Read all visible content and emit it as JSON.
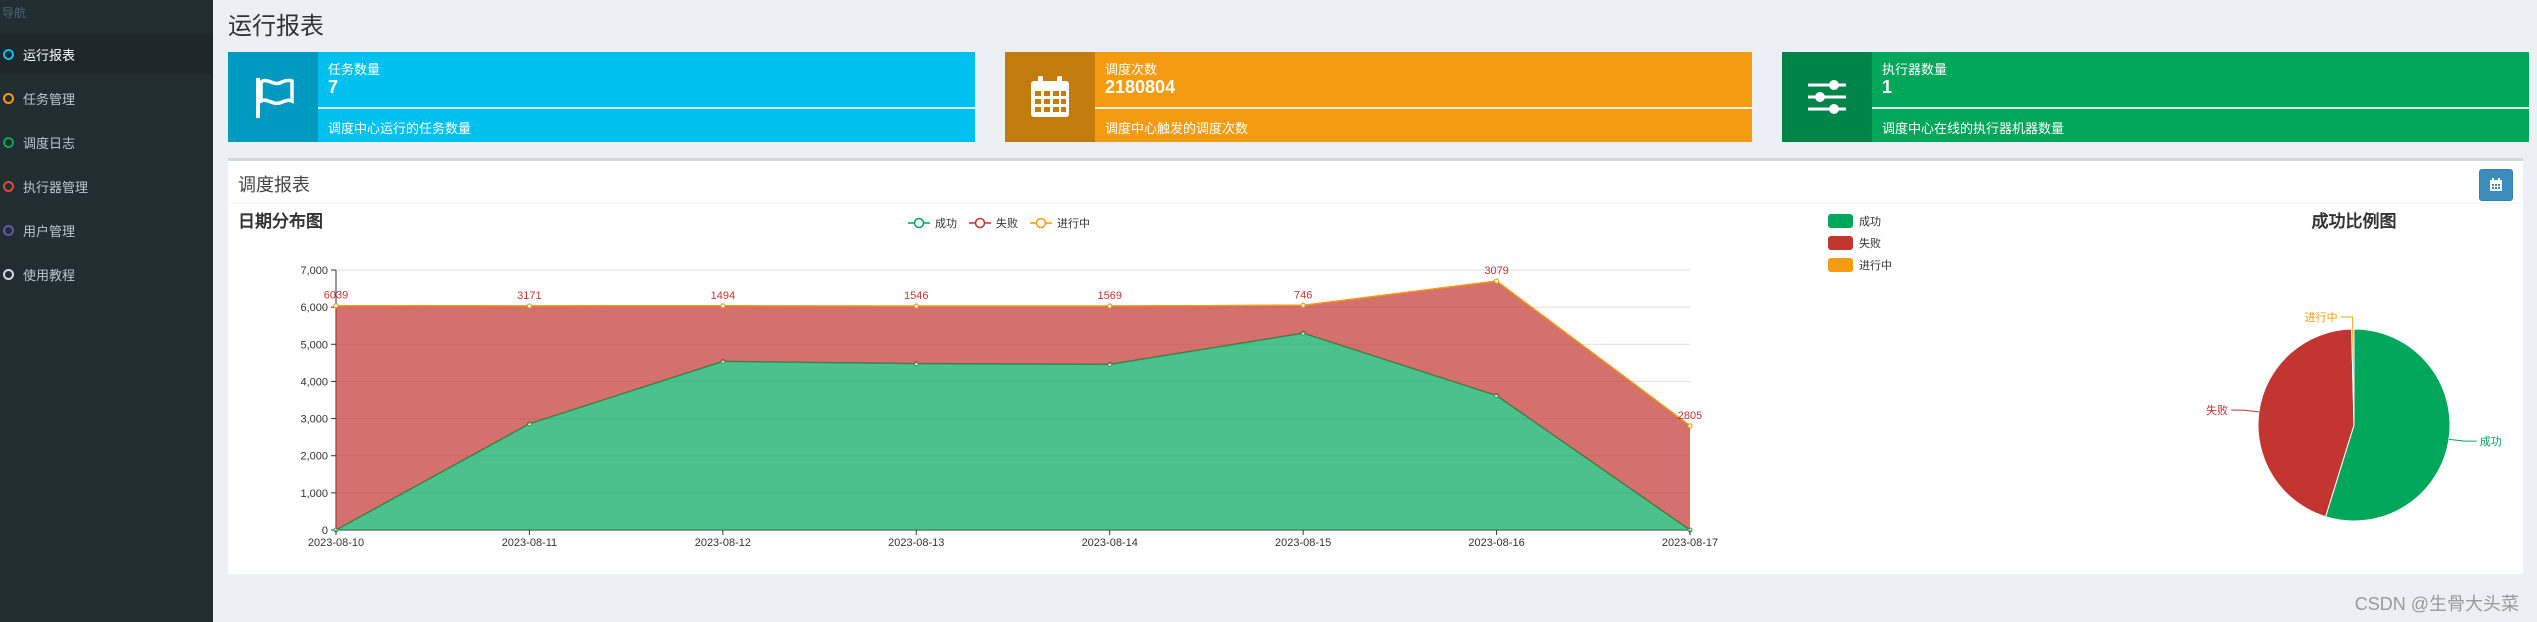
{
  "sidebar": {
    "header": "导航",
    "items": [
      {
        "label": "运行报表",
        "color": "#00c0ef"
      },
      {
        "label": "任务管理",
        "color": "#f39c12"
      },
      {
        "label": "调度日志",
        "color": "#00a65a"
      },
      {
        "label": "执行器管理",
        "color": "#dd4b39"
      },
      {
        "label": "用户管理",
        "color": "#605ca8"
      },
      {
        "label": "使用教程",
        "color": "#d2d6de"
      }
    ]
  },
  "page": {
    "title": "运行报表"
  },
  "info_boxes": [
    {
      "label": "任务数量",
      "value": "7",
      "desc": "调度中心运行的任务数量",
      "color": "#00c0ef",
      "icon": "flag-icon"
    },
    {
      "label": "调度次数",
      "value": "2180804",
      "desc": "调度中心触发的调度次数",
      "color": "#f39c12",
      "icon": "calendar-icon"
    },
    {
      "label": "执行器数量",
      "value": "1",
      "desc": "调度中心在线的执行器机器数量",
      "color": "#00a65a",
      "icon": "sliders-icon"
    }
  ],
  "report": {
    "title": "调度报表",
    "button_icon": "calendar-icon"
  },
  "watermark": "CSDN @生骨大头菜",
  "chart_data": [
    {
      "type": "area",
      "title": "日期分布图",
      "categories": [
        "2023-08-10",
        "2023-08-11",
        "2023-08-12",
        "2023-08-13",
        "2023-08-14",
        "2023-08-15",
        "2023-08-16",
        "2023-08-17"
      ],
      "ylim": [
        0,
        7000
      ],
      "yticks": [
        "0",
        "1,000",
        "2,000",
        "3,000",
        "4,000",
        "5,000",
        "6,000",
        "7,000"
      ],
      "stacked": true,
      "grid": true,
      "legend_position": "top",
      "series": [
        {
          "name": "成功",
          "color": "#00a65a",
          "values": [
            0,
            2860,
            4540,
            4480,
            4460,
            5300,
            3620,
            0
          ]
        },
        {
          "name": "失败",
          "color": "#c23531",
          "values": [
            6039,
            3171,
            1494,
            1546,
            1569,
            746,
            3079,
            2805
          ]
        },
        {
          "name": "进行中",
          "color": "#f39c12",
          "values": [
            0,
            0,
            0,
            0,
            0,
            0,
            0,
            0
          ]
        }
      ],
      "data_labels": [
        "6039",
        "3171",
        "1494",
        "1546",
        "1569",
        "746",
        "3079",
        "2805"
      ]
    },
    {
      "type": "pie",
      "title": "成功比例图",
      "legend_position": "top-left",
      "slices": [
        {
          "name": "成功",
          "value": 55,
          "color": "#00a65a"
        },
        {
          "name": "失败",
          "value": 45,
          "color": "#c23531"
        },
        {
          "name": "进行中",
          "value": 0.4,
          "color": "#f39c12"
        }
      ]
    }
  ]
}
